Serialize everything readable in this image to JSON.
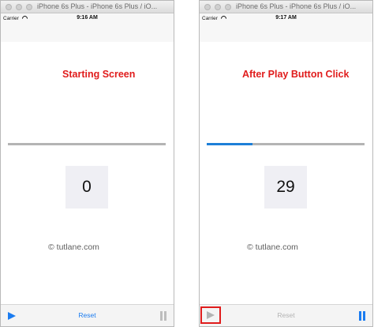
{
  "left": {
    "window_title": "iPhone 6s Plus - iPhone 6s Plus / iO...",
    "carrier": "Carrier",
    "time": "9:16 AM",
    "heading": "Starting Screen",
    "counter": "0",
    "progress": 0,
    "watermark": "© tutlane.com",
    "reset_label": "Reset"
  },
  "right": {
    "window_title": "iPhone 6s Plus - iPhone 6s Plus / iO...",
    "carrier": "Carrier",
    "time": "9:17 AM",
    "heading": "After Play Button Click",
    "counter": "29",
    "progress": 0.29,
    "watermark": "© tutlane.com",
    "reset_label": "Reset"
  },
  "colors": {
    "heading_red": "#e01c1c",
    "ios_blue": "#1b7cf0",
    "progress_blue": "#1d7fd8",
    "disabled_gray": "#b3b3b3"
  },
  "icons": [
    "play-icon",
    "pause-icon",
    "wifi-icon"
  ]
}
